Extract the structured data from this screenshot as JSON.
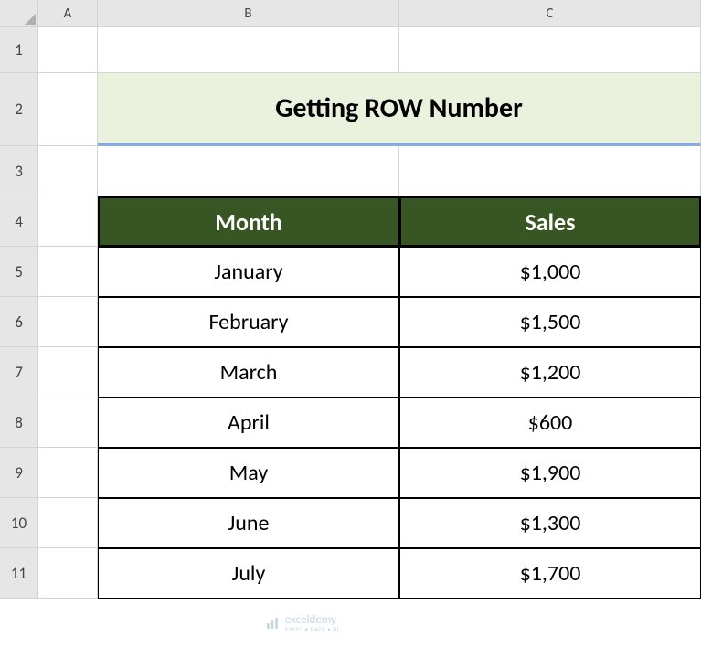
{
  "columns": [
    "A",
    "B",
    "C"
  ],
  "rows": [
    "1",
    "2",
    "3",
    "4",
    "5",
    "6",
    "7",
    "8",
    "9",
    "10",
    "11"
  ],
  "title": "Getting ROW Number",
  "table": {
    "headers": [
      "Month",
      "Sales"
    ],
    "data": [
      {
        "month": "January",
        "sales": "$1,000"
      },
      {
        "month": "February",
        "sales": "$1,500"
      },
      {
        "month": "March",
        "sales": "$1,200"
      },
      {
        "month": "April",
        "sales": "$600"
      },
      {
        "month": "May",
        "sales": "$1,900"
      },
      {
        "month": "June",
        "sales": "$1,300"
      },
      {
        "month": "July",
        "sales": "$1,700"
      }
    ]
  },
  "watermark": {
    "brand": "exceldemy",
    "tagline": "EXCEL • DATA • BI"
  },
  "chart_data": {
    "type": "table",
    "title": "Getting ROW Number",
    "categories": [
      "January",
      "February",
      "March",
      "April",
      "May",
      "June",
      "July"
    ],
    "series": [
      {
        "name": "Sales",
        "values": [
          1000,
          1500,
          1200,
          600,
          1900,
          1300,
          1700
        ]
      }
    ],
    "xlabel": "Month",
    "ylabel": "Sales"
  }
}
